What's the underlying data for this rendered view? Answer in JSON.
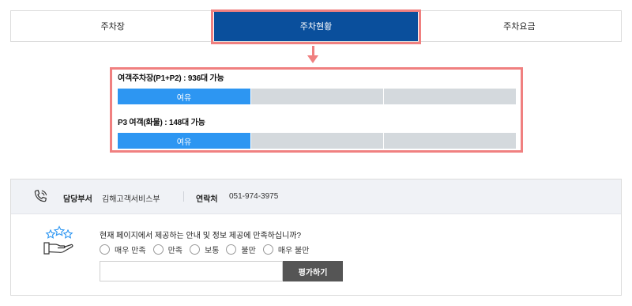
{
  "tabs": [
    {
      "label": "주차장"
    },
    {
      "label": "주차현황"
    },
    {
      "label": "주차요금"
    }
  ],
  "parking_status": {
    "lots": [
      {
        "label": "여객주차장(P1+P2) : 936대 가능",
        "status": "여유",
        "level_segments": 1,
        "total_segments": 3
      },
      {
        "label": "P3 여객(화물) : 148대 가능",
        "status": "여유",
        "level_segments": 1,
        "total_segments": 3
      }
    ]
  },
  "contact": {
    "dept_title": "담당부서",
    "dept_name": "김해고객서비스부",
    "contact_title": "연락처",
    "contact_number": "051-974-3975"
  },
  "survey": {
    "question": "현재 페이지에서 제공하는 안내 및 정보 제공에 만족하십니까?",
    "options": [
      {
        "label": "매우 만족"
      },
      {
        "label": "만족"
      },
      {
        "label": "보통"
      },
      {
        "label": "불만"
      },
      {
        "label": "매우 불만"
      }
    ],
    "comment_value": "",
    "submit_label": "평가하기"
  },
  "colors": {
    "tab_active": "#0a4f9c",
    "highlight": "#f08080",
    "bar_fill": "#2d96f2",
    "bar_empty": "#d4d9dd",
    "submit_bg": "#555555"
  },
  "icons": [
    "phone-icon",
    "survey-hand-stars-icon",
    "down-arrow-icon"
  ]
}
